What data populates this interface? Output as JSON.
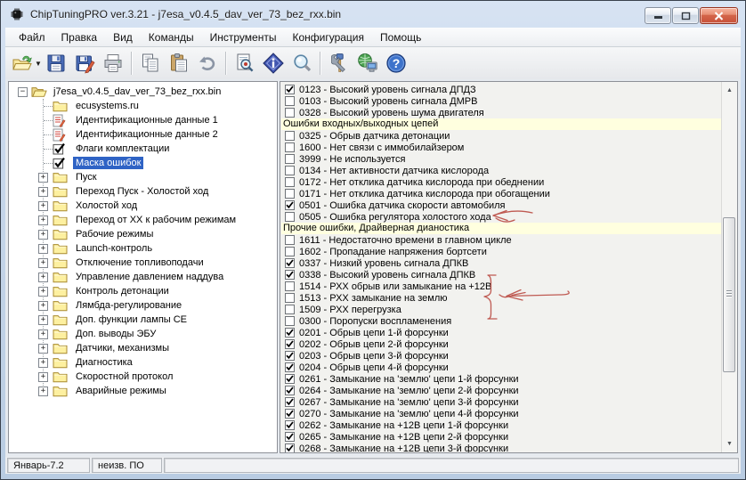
{
  "window": {
    "title": "ChipTuningPRO ver.3.21 - j7esa_v0.4.5_dav_ver_73_bez_rxx.bin",
    "app_icon": "chip-icon",
    "controls": [
      {
        "name": "minimize-button",
        "icon": "minimize-icon"
      },
      {
        "name": "restore-button",
        "icon": "restore-icon"
      },
      {
        "name": "close-button",
        "icon": "close-icon"
      }
    ]
  },
  "menu_bar": {
    "items": [
      {
        "label": "Файл"
      },
      {
        "label": "Правка"
      },
      {
        "label": "Вид"
      },
      {
        "label": "Команды"
      },
      {
        "label": "Инструменты"
      },
      {
        "label": "Конфигурация"
      },
      {
        "label": "Помощь"
      }
    ]
  },
  "toolbar": {
    "buttons": [
      {
        "icon": "open-file-icon",
        "has_dropdown": true
      },
      {
        "icon": "save-icon"
      },
      {
        "icon": "save-as-icon"
      },
      {
        "icon": "print-icon",
        "separator_after": true
      },
      {
        "icon": "copy-icon"
      },
      {
        "icon": "paste-icon"
      },
      {
        "icon": "undo-icon",
        "separator_after": true
      },
      {
        "icon": "view-document-icon"
      },
      {
        "icon": "info-icon"
      },
      {
        "icon": "search-icon",
        "separator_after": true
      },
      {
        "icon": "tools-icon"
      },
      {
        "icon": "network-icon"
      },
      {
        "icon": "help-icon"
      }
    ]
  },
  "tree": {
    "items": [
      {
        "label": "j7esa_v0.4.5_dav_ver_73_bez_rxx.bin",
        "icon": "folder-open-icon",
        "expander": "minus",
        "level": 0
      },
      {
        "label": "ecusystems.ru",
        "icon": "folder-icon",
        "level": 1
      },
      {
        "label": "Идентификационные данные 1",
        "icon": "document-edit-icon",
        "level": 1
      },
      {
        "label": "Идентификационные данные 2",
        "icon": "document-edit-icon",
        "level": 1
      },
      {
        "label": "Флаги комплектации",
        "icon": "checkbox-icon",
        "level": 1
      },
      {
        "label": "Маска ошибок",
        "icon": "checkbox-icon",
        "level": 1,
        "selected": true
      },
      {
        "label": "Пуск",
        "icon": "folder-icon",
        "expander": "plus",
        "level": 1
      },
      {
        "label": "Переход Пуск - Холостой ход",
        "icon": "folder-icon",
        "expander": "plus",
        "level": 1
      },
      {
        "label": "Холостой ход",
        "icon": "folder-icon",
        "expander": "plus",
        "level": 1
      },
      {
        "label": "Переход от ХХ к рабочим режимам",
        "icon": "folder-icon",
        "expander": "plus",
        "level": 1
      },
      {
        "label": "Рабочие режимы",
        "icon": "folder-icon",
        "expander": "plus",
        "level": 1
      },
      {
        "label": "Launch-контроль",
        "icon": "folder-icon",
        "expander": "plus",
        "level": 1
      },
      {
        "label": "Отключение топливоподачи",
        "icon": "folder-icon",
        "expander": "plus",
        "level": 1
      },
      {
        "label": "Управление давлением наддува",
        "icon": "folder-icon",
        "expander": "plus",
        "level": 1
      },
      {
        "label": "Контроль детонации",
        "icon": "folder-icon",
        "expander": "plus",
        "level": 1
      },
      {
        "label": "Лямбда-регулирование",
        "icon": "folder-icon",
        "expander": "plus",
        "level": 1
      },
      {
        "label": "Доп. функции лампы CE",
        "icon": "folder-icon",
        "expander": "plus",
        "level": 1
      },
      {
        "label": "Доп. выводы ЭБУ",
        "icon": "folder-icon",
        "expander": "plus",
        "level": 1
      },
      {
        "label": "Датчики, механизмы",
        "icon": "folder-icon",
        "expander": "plus",
        "level": 1
      },
      {
        "label": "Диагностика",
        "icon": "folder-icon",
        "expander": "plus",
        "level": 1
      },
      {
        "label": "Скоростной протокол",
        "icon": "folder-icon",
        "expander": "plus",
        "level": 1
      },
      {
        "label": "Аварийные режимы",
        "icon": "folder-icon",
        "expander": "plus",
        "level": 1
      }
    ]
  },
  "error_list": {
    "label_separator": " - ",
    "rows": [
      {
        "type": "check",
        "checked": true,
        "code": "0123",
        "text": "Высокий уровень сигнала ДПДЗ"
      },
      {
        "type": "check",
        "checked": false,
        "code": "0103",
        "text": "Высокий уровень сигнала ДМРВ"
      },
      {
        "type": "check",
        "checked": false,
        "code": "0328",
        "text": "Высокий уровень шума двигателя"
      },
      {
        "type": "header",
        "text": "Ошибки входных/выходных цепей"
      },
      {
        "type": "check",
        "checked": false,
        "code": "0325",
        "text": "Обрыв датчика детонации"
      },
      {
        "type": "check",
        "checked": false,
        "code": "1600",
        "text": "Нет связи с иммобилайзером"
      },
      {
        "type": "check",
        "checked": false,
        "code": "3999",
        "text": "Не используется"
      },
      {
        "type": "check",
        "checked": false,
        "code": "0134",
        "text": "Нет активности датчика кислорода"
      },
      {
        "type": "check",
        "checked": false,
        "code": "0172",
        "text": "Нет отклика датчика кислорода при обеднении"
      },
      {
        "type": "check",
        "checked": false,
        "code": "0171",
        "text": "Нет отклика датчика кислорода при обогащении"
      },
      {
        "type": "check",
        "checked": true,
        "code": "0501",
        "text": "Ошибка датчика скорости автомобиля"
      },
      {
        "type": "check",
        "checked": false,
        "code": "0505",
        "text": "Ошибка регулятора холостого хода"
      },
      {
        "type": "header",
        "text": "Прочие ошибки, Драйверная дианостика"
      },
      {
        "type": "check",
        "checked": false,
        "code": "1611",
        "text": "Недостаточно времени в главном цикле"
      },
      {
        "type": "check",
        "checked": false,
        "code": "1602",
        "text": "Пропадание напряжения бортсети"
      },
      {
        "type": "check",
        "checked": true,
        "code": "0337",
        "text": "Низкий уровень сигнала ДПКВ"
      },
      {
        "type": "check",
        "checked": true,
        "code": "0338",
        "text": "Высокий уровень сигнала ДПКВ"
      },
      {
        "type": "check",
        "checked": false,
        "code": "1514",
        "text": "РХХ обрыв или замыкание на +12В"
      },
      {
        "type": "check",
        "checked": false,
        "code": "1513",
        "text": "РХХ замыкание на землю"
      },
      {
        "type": "check",
        "checked": false,
        "code": "1509",
        "text": "РХХ перегрузка"
      },
      {
        "type": "check",
        "checked": false,
        "code": "0300",
        "text": "Поропуски воспламенения"
      },
      {
        "type": "check",
        "checked": true,
        "code": "0201",
        "text": "Обрыв цепи 1-й форсунки"
      },
      {
        "type": "check",
        "checked": true,
        "code": "0202",
        "text": "Обрыв цепи 2-й форсунки"
      },
      {
        "type": "check",
        "checked": true,
        "code": "0203",
        "text": "Обрыв цепи 3-й форсунки"
      },
      {
        "type": "check",
        "checked": true,
        "code": "0204",
        "text": "Обрыв цепи 4-й форсунки"
      },
      {
        "type": "check",
        "checked": true,
        "code": "0261",
        "text": "Замыкание на 'землю' цепи 1-й форсунки"
      },
      {
        "type": "check",
        "checked": true,
        "code": "0264",
        "text": "Замыкание на 'землю' цепи 2-й форсунки"
      },
      {
        "type": "check",
        "checked": true,
        "code": "0267",
        "text": "Замыкание на 'землю' цепи 3-й форсунки"
      },
      {
        "type": "check",
        "checked": true,
        "code": "0270",
        "text": "Замыкание на 'землю' цепи 4-й форсунки"
      },
      {
        "type": "check",
        "checked": true,
        "code": "0262",
        "text": "Замыкание на +12В цепи 1-й форсунки"
      },
      {
        "type": "check",
        "checked": true,
        "code": "0265",
        "text": "Замыкание на +12В цепи 2-й форсунки"
      },
      {
        "type": "check",
        "checked": true,
        "code": "0268",
        "text": "Замыкание на +12В цепи 3-й форсунки"
      }
    ]
  },
  "status_bar": {
    "sections": [
      {
        "text": "Январь-7.2"
      },
      {
        "text": "неизв. ПО"
      },
      {
        "text": ""
      }
    ]
  },
  "annotations": {
    "items": [
      "hand-drawn-arrow-at-0505",
      "hand-drawn-brace-rxx-codes",
      "hand-drawn-arrow-at-rxx-codes"
    ],
    "color": "#bf5a52"
  },
  "colors": {
    "selection": "#2f63c5",
    "section_header_bg": "#ffffdf",
    "titlebar_top": "#d7e3f3",
    "titlebar_bottom": "#b9cce2",
    "annotation": "#bf5a52"
  }
}
